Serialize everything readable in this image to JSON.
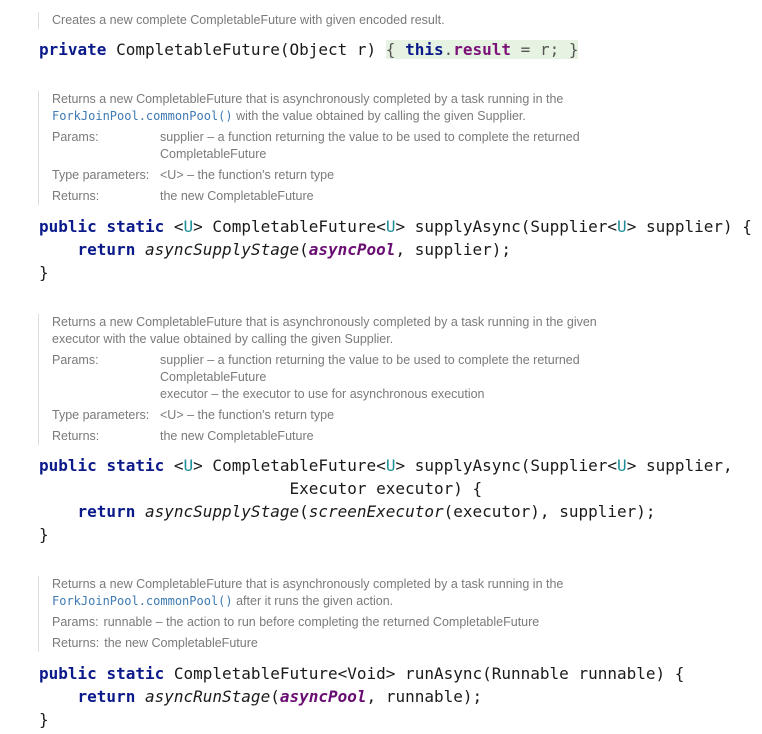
{
  "block1": {
    "doc": "Creates a new complete CompletableFuture with given encoded result.",
    "code": {
      "kw_private": "private",
      "ctor": " CompletableFuture(Object r) ",
      "brace_open": "{",
      "kw_this": "this",
      "dot": ".",
      "field_result": "result",
      "assign": " = r; ",
      "brace_close": "}"
    }
  },
  "block2": {
    "doc_line1": "Returns a new CompletableFuture that is asynchronously completed by a task running in the",
    "doc_link": "ForkJoinPool.commonPool()",
    "doc_line2_rest": " with the value obtained by calling the given Supplier.",
    "params_label": "Params:",
    "params_l1": "supplier – a function returning the value to be used to complete the returned",
    "params_l2": "CompletableFuture",
    "typeparams_label": "Type parameters:",
    "typeparams_value": "<U> – the function's return type",
    "returns_label": "Returns:",
    "returns_value": "the new CompletableFuture",
    "code": {
      "kw_public": "public",
      "kw_static": "static",
      "lt": "<",
      "type_U": "U",
      "gt": ">",
      "sig_a": " CompletableFuture",
      "sig_b": " supplyAsync(Supplier",
      "sig_c": " supplier) {",
      "kw_return": "return",
      "call": "asyncSupplyStage",
      "paren_open": "(",
      "field_pool": "asyncPool",
      "rest": ", supplier);",
      "close": "}"
    }
  },
  "block3": {
    "doc_line1": "Returns a new CompletableFuture that is asynchronously completed by a task running in the given",
    "doc_line2": "executor with the value obtained by calling the given Supplier.",
    "params_label": "Params:",
    "params_l1": "supplier – a function returning the value to be used to complete the returned",
    "params_l2": "CompletableFuture",
    "params_l3": "executor – the executor to use for asynchronous execution",
    "typeparams_label": "Type parameters:",
    "typeparams_value": "<U> – the function's return type",
    "returns_label": "Returns:",
    "returns_value": "the new CompletableFuture",
    "code": {
      "kw_public": "public",
      "kw_static": "static",
      "lt": "<",
      "type_U": "U",
      "gt": ">",
      "sig_a": " CompletableFuture",
      "sig_b": " supplyAsync(Supplier",
      "sig_c": " supplier,",
      "sig_cont": "Executor executor) {",
      "kw_return": "return",
      "call": "asyncSupplyStage",
      "paren_open": "(",
      "inner_call": "screenExecutor",
      "rest": "(executor), supplier);",
      "close": "}"
    }
  },
  "block4": {
    "doc_line1": "Returns a new CompletableFuture that is asynchronously completed by a task running in the",
    "doc_link": "ForkJoinPool.commonPool()",
    "doc_line2_rest": " after it runs the given action.",
    "params_label": "Params:",
    "params_value": "runnable – the action to run before completing the returned CompletableFuture",
    "returns_label": "Returns:",
    "returns_value": "the new CompletableFuture",
    "code": {
      "kw_public": "public",
      "kw_static": "static",
      "sig": " CompletableFuture<Void> runAsync(Runnable runnable) {",
      "kw_return": "return",
      "call": "asyncRunStage",
      "paren_open": "(",
      "field_pool": "asyncPool",
      "rest": ", runnable);",
      "close": "}"
    }
  }
}
